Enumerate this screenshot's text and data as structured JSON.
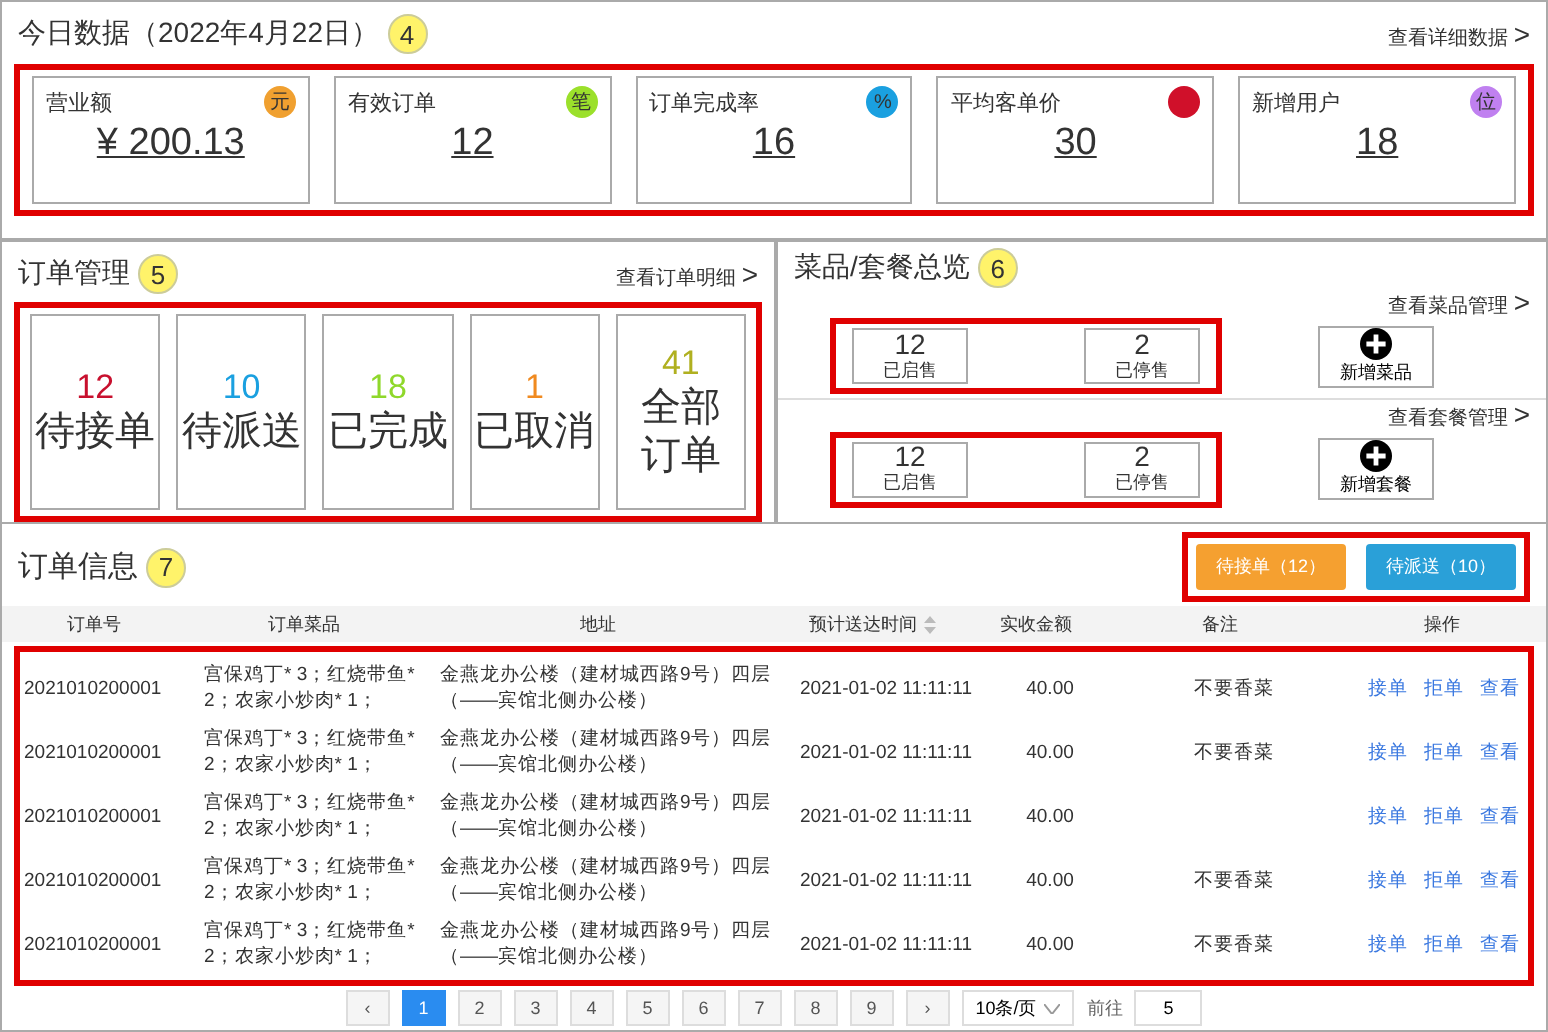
{
  "today": {
    "title": "今日数据（2022年4月22日）",
    "callout": "4",
    "link": "查看详细数据",
    "link_arrow": ">",
    "cards": [
      {
        "label": "营业额",
        "value": "¥ 200.13",
        "badge": "元",
        "color": "#f0a030"
      },
      {
        "label": "有效订单",
        "value": "12",
        "badge": "笔",
        "color": "#9be02b"
      },
      {
        "label": "订单完成率",
        "value": "16",
        "badge": "%",
        "color": "#1aa0e0"
      },
      {
        "label": "平均客单价",
        "value": "30",
        "color": "#d0102a"
      },
      {
        "label": "新增用户",
        "value": "18",
        "badge": "位",
        "color": "#c080f0"
      }
    ]
  },
  "orders": {
    "title": "订单管理",
    "callout": "5",
    "link": "查看订单明细",
    "link_arrow": ">",
    "tiles": [
      {
        "count": "12",
        "label": "待接单",
        "color": "#c8102e"
      },
      {
        "count": "10",
        "label": "待派送",
        "color": "#1aa0e0"
      },
      {
        "count": "18",
        "label": "已完成",
        "color": "#8fd82b"
      },
      {
        "count": "1",
        "label": "已取消",
        "color": "#f08a20"
      },
      {
        "count": "41",
        "label": "全部订单",
        "color": "#b0b020"
      }
    ]
  },
  "overview": {
    "title": "菜品/套餐总览",
    "callout": "6",
    "groups": [
      {
        "link": "查看菜品管理",
        "link_arrow": ">",
        "stats": [
          {
            "count": "12",
            "label": "已启售"
          },
          {
            "count": "2",
            "label": "已停售"
          }
        ],
        "add": "新增菜品"
      },
      {
        "link": "查看套餐管理",
        "link_arrow": ">",
        "stats": [
          {
            "count": "12",
            "label": "已启售"
          },
          {
            "count": "2",
            "label": "已停售"
          }
        ],
        "add": "新增套餐"
      }
    ]
  },
  "info": {
    "title": "订单信息",
    "callout": "7",
    "buttons": [
      {
        "label": "待接单（12）",
        "color": "#f5a030"
      },
      {
        "label": "待派送（10）",
        "color": "#2aa0d8"
      }
    ],
    "columns": [
      "订单号",
      "订单菜品",
      "地址",
      "预计送达时间",
      "实收金额",
      "备注",
      "操作"
    ],
    "rows": [
      {
        "id": "2021010200001",
        "dishes": "宫保鸡丁* 3；红烧带鱼* 2；农家小炒肉* 1；",
        "address": "金燕龙办公楼（建材城西路9号）四层（——宾馆北侧办公楼）",
        "time": "2021-01-02 11:11:11",
        "amount": "40.00",
        "remark": "不要香菜",
        "actions": [
          "接单",
          "拒单",
          "查看"
        ]
      },
      {
        "id": "2021010200001",
        "dishes": "宫保鸡丁* 3；红烧带鱼* 2；农家小炒肉* 1；",
        "address": "金燕龙办公楼（建材城西路9号）四层（——宾馆北侧办公楼）",
        "time": "2021-01-02 11:11:11",
        "amount": "40.00",
        "remark": "不要香菜",
        "actions": [
          "接单",
          "拒单",
          "查看"
        ]
      },
      {
        "id": "2021010200001",
        "dishes": "宫保鸡丁* 3；红烧带鱼* 2；农家小炒肉* 1；",
        "address": "金燕龙办公楼（建材城西路9号）四层（——宾馆北侧办公楼）",
        "time": "2021-01-02 11:11:11",
        "amount": "40.00",
        "actions": [
          "接单",
          "拒单",
          "查看"
        ]
      },
      {
        "id": "2021010200001",
        "dishes": "宫保鸡丁* 3；红烧带鱼* 2；农家小炒肉* 1；",
        "address": "金燕龙办公楼（建材城西路9号）四层（——宾馆北侧办公楼）",
        "time": "2021-01-02 11:11:11",
        "amount": "40.00",
        "remark": "不要香菜",
        "actions": [
          "接单",
          "拒单",
          "查看"
        ]
      },
      {
        "id": "2021010200001",
        "dishes": "宫保鸡丁* 3；红烧带鱼* 2；农家小炒肉* 1；",
        "address": "金燕龙办公楼（建材城西路9号）四层（——宾馆北侧办公楼）",
        "time": "2021-01-02 11:11:11",
        "amount": "40.00",
        "remark": "不要香菜",
        "actions": [
          "接单",
          "拒单",
          "查看"
        ]
      }
    ],
    "pagination": {
      "prev": "‹",
      "pages": [
        {
          "label": "1",
          "selected": true
        },
        {
          "label": "2",
          "selected": false
        },
        {
          "label": "3",
          "selected": false
        },
        {
          "label": "4",
          "selected": false
        },
        {
          "label": "5",
          "selected": false
        },
        {
          "label": "6",
          "selected": false
        },
        {
          "label": "7",
          "selected": false
        },
        {
          "label": "8",
          "selected": false
        },
        {
          "label": "9",
          "selected": false
        }
      ],
      "next": "›",
      "page_size": "10条/页",
      "jump_label": "前往",
      "jump_value": "5"
    }
  }
}
